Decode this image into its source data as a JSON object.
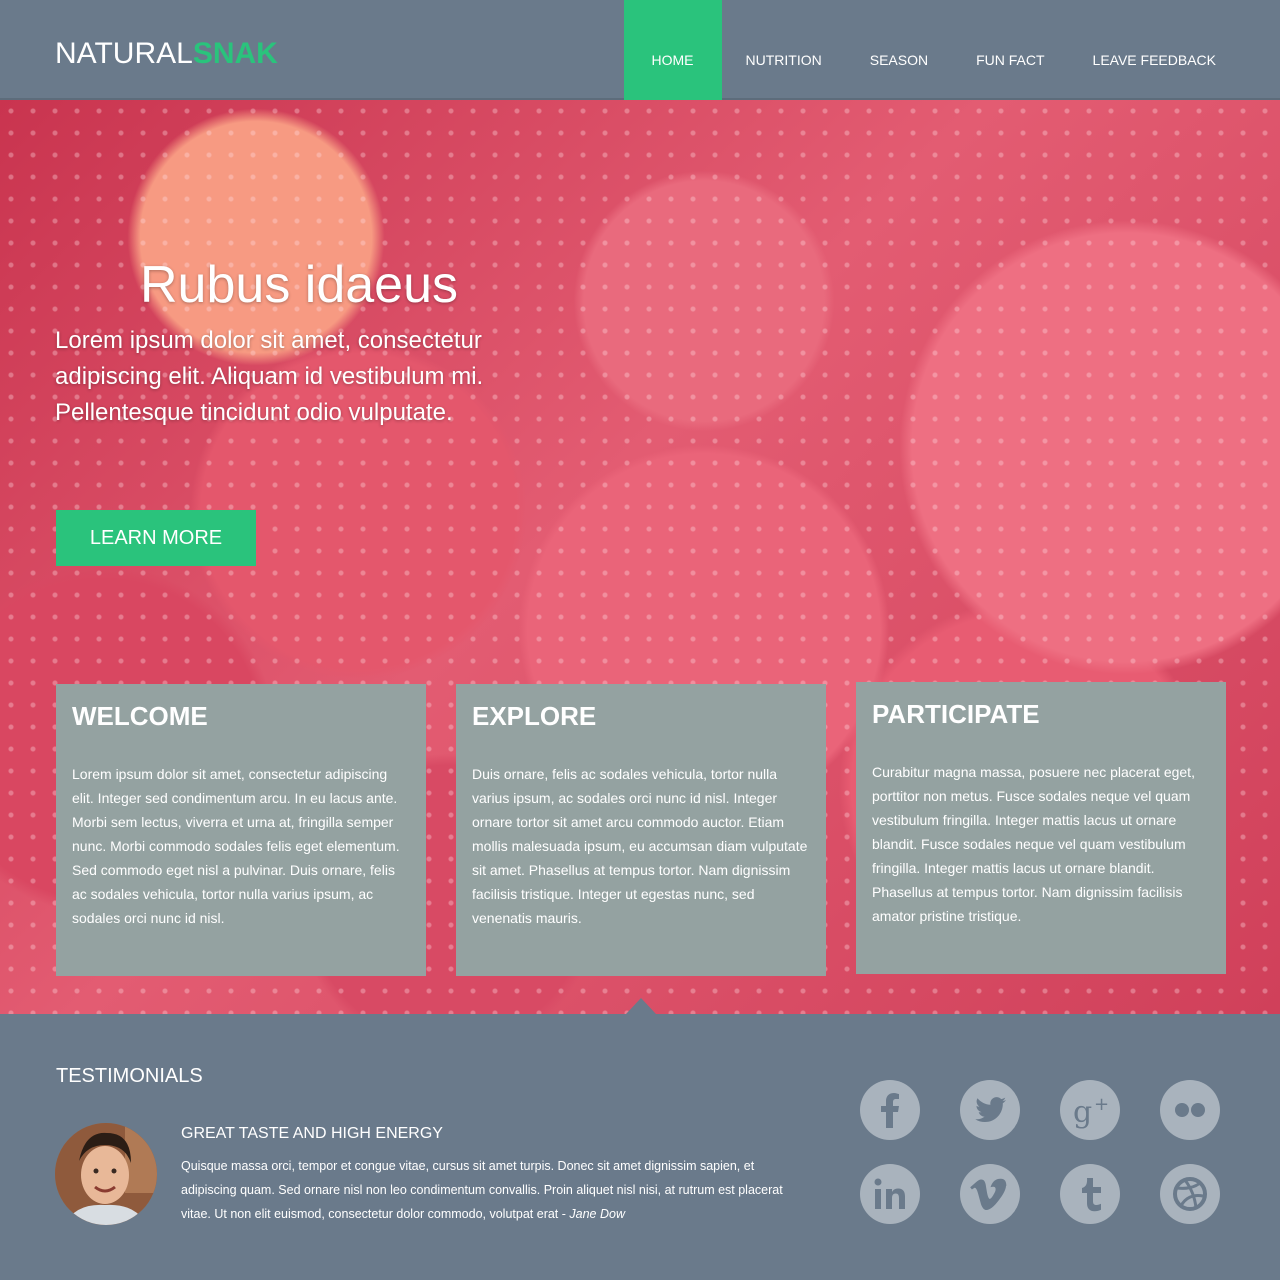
{
  "brand": {
    "part1": "NATURAL",
    "part2": "SNAK"
  },
  "nav": {
    "items": [
      {
        "label": "HOME"
      },
      {
        "label": "NUTRITION"
      },
      {
        "label": "SEASON"
      },
      {
        "label": "FUN FACT"
      },
      {
        "label": "LEAVE FEEDBACK"
      }
    ],
    "active": "HOME"
  },
  "hero": {
    "title": "Rubus idaeus",
    "subtitle": "Lorem ipsum dolor sit amet, consectetur adipiscing elit. Aliquam id vestibulum mi. Pellentesque tincidunt odio vulputate.",
    "button": "LEARN MORE"
  },
  "panels": [
    {
      "title": "WELCOME",
      "text": "Lorem ipsum dolor sit amet, consectetur adipiscing elit. Integer sed condimentum arcu. In eu lacus ante. Morbi sem lectus, viverra et urna at, fringilla semper nunc. Morbi commodo sodales felis eget elementum. Sed commodo eget nisl a pulvinar. Duis ornare, felis ac sodales vehicula, tortor nulla varius ipsum, ac sodales orci nunc id nisl."
    },
    {
      "title": "EXPLORE",
      "text": "Duis ornare, felis ac sodales vehicula, tortor nulla varius ipsum, ac sodales orci nunc id nisl. Integer ornare tortor sit amet arcu commodo auctor. Etiam mollis malesuada ipsum, eu accumsan diam vulputate sit amet. Phasellus at tempus tortor. Nam dignissim facilisis tristique. Integer ut egestas nunc, sed venenatis mauris."
    },
    {
      "title": "PARTICIPATE",
      "text": "Curabitur magna massa, posuere nec placerat eget, porttitor non metus. Fusce sodales neque vel quam vestibulum fringilla. Integer mattis lacus ut ornare blandit. Fusce sodales neque vel quam vestibulum fringilla. Integer mattis lacus ut ornare blandit. Phasellus at tempus tortor. Nam dignissim facilisis amator pristine tristique."
    }
  ],
  "testimonials": {
    "title": "TESTIMONIALS",
    "heading": "GREAT TASTE AND HIGH ENERGY",
    "text": "Quisque massa orci, tempor et congue vitae, cursus sit amet turpis. Donec sit amet dignissim sapien, et adipiscing quam. Sed ornare nisl non leo condimentum convallis. Proin aliquet nisl nisi, at rutrum est placerat vitae. Ut non elit euismod, consectetur dolor commodo, volutpat erat - ",
    "author": "Jane Dow"
  },
  "social": [
    "facebook-icon",
    "twitter-icon",
    "google-plus-icon",
    "flickr-icon",
    "linkedin-icon",
    "vimeo-icon",
    "tumblr-icon",
    "dribbble-icon"
  ],
  "colors": {
    "accent": "#2ac37c",
    "header_bg": "#6a7a8b",
    "panel_bg": "#94a2a1",
    "icon_bg": "#a9b3bd"
  }
}
